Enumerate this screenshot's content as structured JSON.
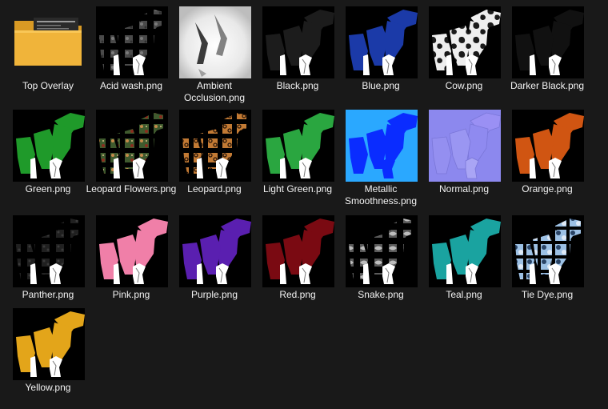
{
  "files": [
    {
      "label": "Top Overlay",
      "icon": "folder-icon",
      "kind": "folder",
      "color": "#f0b43a"
    },
    {
      "label": "Acid wash.png",
      "icon": "image-thumbnail",
      "kind": "pants",
      "color": "#5a5a5a",
      "pattern": "acid"
    },
    {
      "label": "Ambient Occlusion.png",
      "icon": "image-thumbnail",
      "kind": "ao",
      "color": "#ffffff"
    },
    {
      "label": "Black.png",
      "icon": "image-thumbnail",
      "kind": "pants",
      "color": "#1c1c1c"
    },
    {
      "label": "Blue.png",
      "icon": "image-thumbnail",
      "kind": "pants",
      "color": "#1b3aa8"
    },
    {
      "label": "Cow.png",
      "icon": "image-thumbnail",
      "kind": "pants",
      "color": "#e6e6e6",
      "pattern": "cow"
    },
    {
      "label": "Darker Black.png",
      "icon": "image-thumbnail",
      "kind": "pants",
      "color": "#111111"
    },
    {
      "label": "Green.png",
      "icon": "image-thumbnail",
      "kind": "pants",
      "color": "#1f9a2a"
    },
    {
      "label": "Leopard Flowers.png",
      "icon": "image-thumbnail",
      "kind": "pants",
      "color": "#4f6a3a",
      "pattern": "flowers"
    },
    {
      "label": "Leopard.png",
      "icon": "image-thumbnail",
      "kind": "pants",
      "color": "#b5702e",
      "pattern": "leopard"
    },
    {
      "label": "Light Green.png",
      "icon": "image-thumbnail",
      "kind": "pants",
      "color": "#2aa640"
    },
    {
      "label": "Metallic Smoothness.png",
      "icon": "image-thumbnail",
      "kind": "metallic",
      "color": "#0a2cff"
    },
    {
      "label": "Normal.png",
      "icon": "image-thumbnail",
      "kind": "normal",
      "color": "#8a86f0"
    },
    {
      "label": "Orange.png",
      "icon": "image-thumbnail",
      "kind": "pants",
      "color": "#d05512"
    },
    {
      "label": "Panther.png",
      "icon": "image-thumbnail",
      "kind": "pants",
      "color": "#262626",
      "pattern": "panther"
    },
    {
      "label": "Pink.png",
      "icon": "image-thumbnail",
      "kind": "pants",
      "color": "#f07fa8"
    },
    {
      "label": "Purple.png",
      "icon": "image-thumbnail",
      "kind": "pants",
      "color": "#5a1fb0"
    },
    {
      "label": "Red.png",
      "icon": "image-thumbnail",
      "kind": "pants",
      "color": "#7a0a12"
    },
    {
      "label": "Snake.png",
      "icon": "image-thumbnail",
      "kind": "pants",
      "color": "#707070",
      "pattern": "snake"
    },
    {
      "label": "Teal.png",
      "icon": "image-thumbnail",
      "kind": "pants",
      "color": "#1aa3a0"
    },
    {
      "label": "Tie Dye.png",
      "icon": "image-thumbnail",
      "kind": "pants",
      "color": "#8fb0d8",
      "pattern": "tiedye"
    },
    {
      "label": "Yellow.png",
      "icon": "image-thumbnail",
      "kind": "pants",
      "color": "#e3a51a"
    }
  ]
}
